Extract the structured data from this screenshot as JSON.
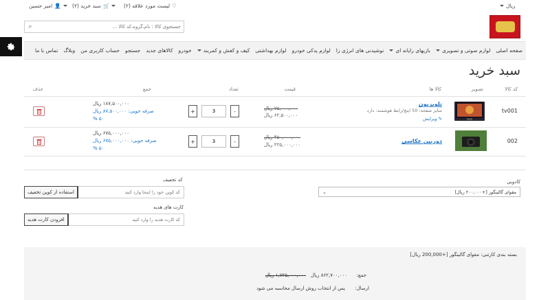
{
  "topbar": {
    "currency": "ریال",
    "wishlist": "لیست مورد علاقه (۲)",
    "cart": "سبد خرید (۲)",
    "user": "امیر حسین"
  },
  "search": {
    "placeholder": "جستجوی کالا : نام،گروه،کد کالا ..."
  },
  "nav": [
    "صفحه اصلی",
    "لوازم صوتی و تصویری",
    "بازیهای رایانه ای",
    "نوشیدنی های انرژی زا",
    "لوازم یدکی خودرو",
    "لوازم بهداشتی",
    "کیف و کفش و کمربند",
    "خودرو",
    "کالاهای جدید",
    "جستجو",
    "حساب کاربری من",
    "وبلاگ",
    "تماس با ما"
  ],
  "page_title": "سبد خرید",
  "table": {
    "headers": {
      "code": "کد کالا",
      "image": "تصویر",
      "product": "کالا ها",
      "price": "قیمت",
      "qty": "تعداد",
      "total": "جمع",
      "remove": "حذف"
    },
    "rows": [
      {
        "code": "tv001",
        "name": "تلویزیون",
        "meta": "سایز صفحه: 50 اینچ/رابط هوشمند: دارد",
        "edit": "ویرایش",
        "old_price": "۷۵,۰۰۰,۰۰۰ ریال",
        "new_price": "۶۲,۵۰۰,۰۰۰ ریال",
        "qty": "3",
        "total": "۱۸۷,۵۰۰,۰۰۰ ریال",
        "saving": "صرفه جویی: ۸۷,۵۰۰,۰۰۰ ریال",
        "percent": "۵۰ %",
        "thumb_color": "#2a2430"
      },
      {
        "code": "002",
        "name": "دوربین عکاسی",
        "meta": "",
        "edit": "",
        "old_price": "۴۵۰,۰۰۰,۰۰۰ ریال",
        "new_price": "۲۲۵,۰۰۰,۰۰۰ ریال",
        "qty": "3",
        "total": "۶۷۵,۰۰۰,۰۰۰ ریال",
        "saving": "صرفه جویی: ۶۷۵,۰۰۰,۰۰۰ ریال",
        "percent": "۵۰ %",
        "thumb_color": "#3b6b2d"
      }
    ],
    "qty_plus": "+",
    "qty_minus": "-"
  },
  "coupon": {
    "label": "کد تخفیف",
    "placeholder": "کد کوپن خود را اینجا وارد کنید",
    "button": "استفاده از کوپن تخفیف"
  },
  "giftcard": {
    "label": "کارت های هدیه",
    "placeholder": "کد کارت هدیه را وارد کنید",
    "button": "افزودن کارت هدیه"
  },
  "packaging": {
    "label": "کادوبی",
    "selected": "مقوای گالینگور [+۲۰۰,۰۰۰ ریال]"
  },
  "summary": {
    "packaging_line": "بسته بندی کارتنی: مقوای گالینگور [+200,000 ریال]",
    "total_label": "جمع:",
    "total_old": "۱,۷۲۵,۰۰۰,۰۰۰ ریال",
    "total_new": "۸۶۲,۷۰۰,۰۰۰ ریال",
    "shipping_label": "ارسال:",
    "shipping_value": "پس از انتخاب روش ارسال محاسبه می شود"
  },
  "colors": {
    "link": "#1a73c8",
    "brand_red": "#c8141e",
    "nav_bg": "#f2f2f2"
  }
}
